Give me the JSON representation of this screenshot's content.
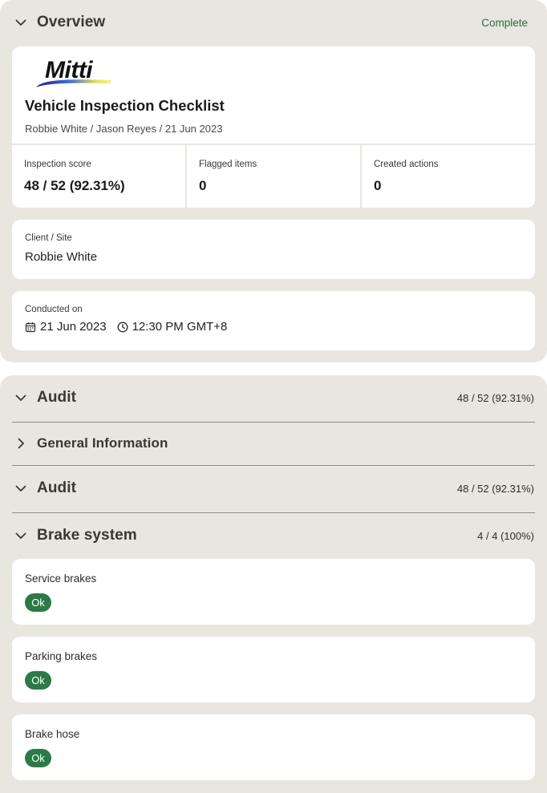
{
  "overview": {
    "title": "Overview",
    "status": "Complete",
    "logo_text": "Mitti",
    "doc_title": "Vehicle Inspection Checklist",
    "doc_meta": "Robbie White / Jason Reyes / 21 Jun 2023",
    "stats": [
      {
        "label": "Inspection score",
        "value": "48 / 52 (92.31%)"
      },
      {
        "label": "Flagged items",
        "value": "0"
      },
      {
        "label": "Created actions",
        "value": "0"
      }
    ],
    "client": {
      "label": "Client / Site",
      "value": "Robbie White"
    },
    "conducted": {
      "label": "Conducted on",
      "date": "21 Jun 2023",
      "time": "12:30 PM GMT+8"
    }
  },
  "audit": {
    "title": "Audit",
    "score": "48 / 52 (92.31%)",
    "sections": [
      {
        "title": "General Information",
        "expanded": false
      },
      {
        "title": "Audit",
        "score": "48 / 52 (92.31%)",
        "expanded": true
      },
      {
        "title": "Brake system",
        "score": "4 / 4 (100%)",
        "expanded": true
      }
    ],
    "items": [
      {
        "label": "Service brakes",
        "response": "Ok"
      },
      {
        "label": "Parking brakes",
        "response": "Ok"
      },
      {
        "label": "Brake hose",
        "response": "Ok"
      }
    ]
  },
  "colors": {
    "panel_bg": "#e9e6e0",
    "ok_green": "#2b7a47",
    "complete_green": "#2f6b3f"
  }
}
